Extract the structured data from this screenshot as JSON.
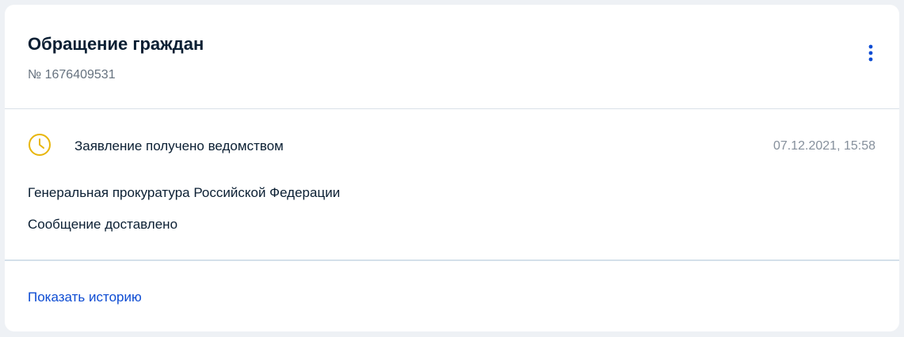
{
  "card": {
    "title": "Обращение граждан",
    "number": "№ 1676409531"
  },
  "menu": {
    "icon": "more-vertical-icon",
    "color": "#0d4cd3"
  },
  "status": {
    "icon": "clock-icon",
    "icon_color": "#e8b60d",
    "text": "Заявление получено ведомством",
    "date": "07.12.2021, 15:58",
    "organization": "Генеральная прокуратура Российской Федерации",
    "message": "Сообщение доставлено"
  },
  "footer": {
    "history_link": "Показать историю"
  }
}
